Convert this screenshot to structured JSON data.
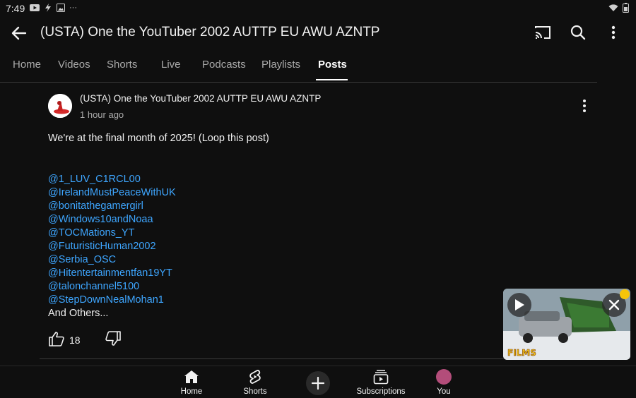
{
  "status_bar": {
    "time": "7:49",
    "more": "···"
  },
  "header": {
    "title": "(USTA) One the YouTuber 2002 AUTTP EU AWU AZNTP"
  },
  "tabs": [
    {
      "label": "Home"
    },
    {
      "label": "Videos"
    },
    {
      "label": "Shorts"
    },
    {
      "label": "Live"
    },
    {
      "label": "Podcasts"
    },
    {
      "label": "Playlists"
    },
    {
      "label": "Posts",
      "active": true
    }
  ],
  "post": {
    "author": "(USTA) One the YouTuber 2002 AUTTP EU AWU AZNTP",
    "time": "1 hour ago",
    "text": "We're at the final month of 2025! (Loop this post)",
    "mentions": [
      "@1_LUV_C1RCL00",
      "@IrelandMustPeaceWithUK",
      "@bonitathegamergirl",
      "@Windows10andNoaa",
      "@TOCMations_YT",
      "@FuturisticHuman2002",
      "@Serbia_OSC",
      "@Hitentertainmentfan19YT",
      "@talonchannel5100",
      "@StepDownNealMohan1"
    ],
    "trailing": "And Others...",
    "likes": "18"
  },
  "mini_player": {
    "logo_text": "FILMS"
  },
  "bottom_nav": [
    {
      "label": "Home"
    },
    {
      "label": "Shorts"
    },
    {
      "label": "Subscriptions"
    },
    {
      "label": "You"
    }
  ],
  "colors": {
    "background": "#0f0f0f",
    "link": "#3ea6ff",
    "text": "#f1f1f1",
    "muted": "#aaaaaa"
  }
}
